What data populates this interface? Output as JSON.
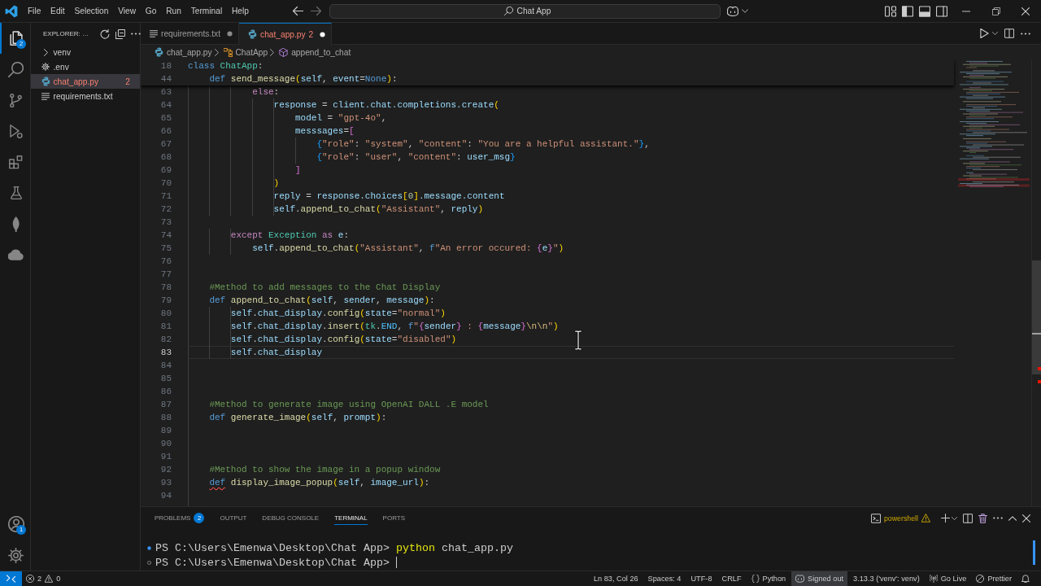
{
  "title_bar": {
    "menu": [
      "File",
      "Edit",
      "Selection",
      "View",
      "Go",
      "Run",
      "Terminal",
      "Help"
    ],
    "search_text": "Chat App"
  },
  "activity_bar": {
    "items": [
      {
        "kind": "files",
        "selected": true,
        "badge": "2"
      },
      {
        "kind": "search",
        "selected": false
      },
      {
        "kind": "source-control",
        "selected": false
      },
      {
        "kind": "run",
        "selected": false
      },
      {
        "kind": "extensions",
        "selected": false
      },
      {
        "kind": "testing",
        "selected": false
      },
      {
        "kind": "leaf",
        "selected": false
      },
      {
        "kind": "cloud",
        "selected": false
      }
    ],
    "bottom": [
      {
        "kind": "account",
        "badge": "1"
      },
      {
        "kind": "settings"
      }
    ]
  },
  "sidebar": {
    "title": "EXPLORER: …",
    "items": [
      {
        "kind": "folder",
        "name": "venv",
        "expanded": false,
        "selected": false,
        "has_errors": false
      },
      {
        "kind": "env",
        "name": ".env",
        "selected": false,
        "has_errors": false
      },
      {
        "kind": "python",
        "name": "chat_app.py",
        "problems": "2",
        "selected": true,
        "has_errors": true
      },
      {
        "kind": "text",
        "name": "requirements.txt",
        "selected": false,
        "has_errors": false
      }
    ]
  },
  "editor": {
    "tabs": [
      {
        "kind": "text",
        "label": "requirements.txt",
        "selected": false,
        "modified": true,
        "has_errors": false
      },
      {
        "kind": "python",
        "label": "chat_app.py",
        "problems": "2",
        "selected": true,
        "modified": true,
        "has_errors": true
      }
    ],
    "breadcrumbs": [
      {
        "kind": "python",
        "text": "chat_app.py"
      },
      {
        "kind": "class",
        "text": "ChatApp"
      },
      {
        "kind": "method",
        "text": "append_to_chat"
      }
    ],
    "sticky_lines": [
      {
        "number": "18",
        "tokens": [
          {
            "kind": "kw",
            "text": "class "
          },
          {
            "kind": "cls",
            "text": "ChatApp"
          },
          {
            "kind": "plain",
            "text": ":"
          }
        ]
      },
      {
        "number": "44",
        "tokens": [
          {
            "kind": "kw",
            "text": "    def "
          },
          {
            "kind": "fn",
            "text": "send_message"
          },
          {
            "kind": "br1",
            "text": "("
          },
          {
            "kind": "var",
            "text": "self"
          },
          {
            "kind": "plain",
            "text": ", "
          },
          {
            "kind": "var",
            "text": "event"
          },
          {
            "kind": "plain",
            "text": "="
          },
          {
            "kind": "kw",
            "text": "None"
          },
          {
            "kind": "br1",
            "text": ")"
          },
          {
            "kind": "plain",
            "text": ":"
          }
        ]
      }
    ],
    "lines": [
      {
        "number": "63",
        "current": false,
        "tokens": [
          {
            "kind": "ctrl",
            "text": "            else"
          },
          {
            "kind": "plain",
            "text": ":"
          }
        ]
      },
      {
        "number": "64",
        "current": false,
        "tokens": [
          {
            "kind": "var",
            "text": "                response"
          },
          {
            "kind": "plain",
            "text": " = "
          },
          {
            "kind": "var",
            "text": "client.chat.completions.create"
          },
          {
            "kind": "br1",
            "text": "("
          }
        ]
      },
      {
        "number": "65",
        "current": false,
        "tokens": [
          {
            "kind": "var",
            "text": "                    model"
          },
          {
            "kind": "plain",
            "text": " = "
          },
          {
            "kind": "str",
            "text": "\"gpt-4o\""
          },
          {
            "kind": "plain",
            "text": ","
          }
        ]
      },
      {
        "number": "66",
        "current": false,
        "tokens": [
          {
            "kind": "var",
            "text": "                    messsages"
          },
          {
            "kind": "plain",
            "text": "="
          },
          {
            "kind": "br2",
            "text": "["
          }
        ]
      },
      {
        "number": "67",
        "current": false,
        "tokens": [
          {
            "kind": "br3",
            "text": "                        {"
          },
          {
            "kind": "str",
            "text": "\"role\""
          },
          {
            "kind": "plain",
            "text": ": "
          },
          {
            "kind": "str",
            "text": "\"system\""
          },
          {
            "kind": "plain",
            "text": ", "
          },
          {
            "kind": "str",
            "text": "\"content\""
          },
          {
            "kind": "plain",
            "text": ": "
          },
          {
            "kind": "str",
            "text": "\"You are a helpful assistant.\""
          },
          {
            "kind": "br3",
            "text": "}"
          },
          {
            "kind": "plain",
            "text": ","
          }
        ]
      },
      {
        "number": "68",
        "current": false,
        "tokens": [
          {
            "kind": "br3",
            "text": "                        {"
          },
          {
            "kind": "str",
            "text": "\"role\""
          },
          {
            "kind": "plain",
            "text": ": "
          },
          {
            "kind": "str",
            "text": "\"user\""
          },
          {
            "kind": "plain",
            "text": ", "
          },
          {
            "kind": "str",
            "text": "\"content\""
          },
          {
            "kind": "plain",
            "text": ": "
          },
          {
            "kind": "var",
            "text": "user_msg"
          },
          {
            "kind": "br3",
            "text": "}"
          }
        ]
      },
      {
        "number": "69",
        "current": false,
        "tokens": [
          {
            "kind": "br2",
            "text": "                    ]"
          }
        ]
      },
      {
        "number": "70",
        "current": false,
        "tokens": [
          {
            "kind": "br1",
            "text": "                )"
          }
        ]
      },
      {
        "number": "71",
        "current": false,
        "tokens": [
          {
            "kind": "var",
            "text": "                reply"
          },
          {
            "kind": "plain",
            "text": " = "
          },
          {
            "kind": "var",
            "text": "response.choices"
          },
          {
            "kind": "br1",
            "text": "["
          },
          {
            "kind": "num",
            "text": "0"
          },
          {
            "kind": "br1",
            "text": "]"
          },
          {
            "kind": "var",
            "text": ".message.content"
          }
        ]
      },
      {
        "number": "72",
        "current": false,
        "tokens": [
          {
            "kind": "var",
            "text": "                self"
          },
          {
            "kind": "plain",
            "text": "."
          },
          {
            "kind": "fn",
            "text": "append_to_chat"
          },
          {
            "kind": "br1",
            "text": "("
          },
          {
            "kind": "str",
            "text": "\"Assistant\""
          },
          {
            "kind": "plain",
            "text": ", "
          },
          {
            "kind": "var",
            "text": "reply"
          },
          {
            "kind": "br1",
            "text": ")"
          }
        ]
      },
      {
        "number": "73",
        "current": false
      },
      {
        "number": "74",
        "current": false,
        "tokens": [
          {
            "kind": "ctrl",
            "text": "        except "
          },
          {
            "kind": "cls",
            "text": "Exception "
          },
          {
            "kind": "ctrl",
            "text": "as "
          },
          {
            "kind": "var",
            "text": "e"
          },
          {
            "kind": "plain",
            "text": ":"
          }
        ]
      },
      {
        "number": "75",
        "current": false,
        "tokens": [
          {
            "kind": "var",
            "text": "            self"
          },
          {
            "kind": "plain",
            "text": "."
          },
          {
            "kind": "fn",
            "text": "append_to_chat"
          },
          {
            "kind": "br1",
            "text": "("
          },
          {
            "kind": "str",
            "text": "\"Assistant\""
          },
          {
            "kind": "plain",
            "text": ", "
          },
          {
            "kind": "kw",
            "text": "f"
          },
          {
            "kind": "str",
            "text": "\"An error occured: "
          },
          {
            "kind": "br2",
            "text": "{"
          },
          {
            "kind": "var",
            "text": "e"
          },
          {
            "kind": "br2",
            "text": "}"
          },
          {
            "kind": "str",
            "text": "\""
          },
          {
            "kind": "br1",
            "text": ")"
          }
        ]
      },
      {
        "number": "76",
        "current": false
      },
      {
        "number": "77",
        "current": false
      },
      {
        "number": "78",
        "current": false,
        "tokens": [
          {
            "kind": "com",
            "text": "    #Method to add messages to the Chat Display"
          }
        ]
      },
      {
        "number": "79",
        "current": false,
        "tokens": [
          {
            "kind": "kw",
            "text": "    def "
          },
          {
            "kind": "fn",
            "text": "append_to_chat"
          },
          {
            "kind": "br1",
            "text": "("
          },
          {
            "kind": "var",
            "text": "self"
          },
          {
            "kind": "plain",
            "text": ", "
          },
          {
            "kind": "var",
            "text": "sender"
          },
          {
            "kind": "plain",
            "text": ", "
          },
          {
            "kind": "var",
            "text": "message"
          },
          {
            "kind": "br1",
            "text": ")"
          },
          {
            "kind": "plain",
            "text": ":"
          }
        ]
      },
      {
        "number": "80",
        "current": false,
        "tokens": [
          {
            "kind": "var",
            "text": "        self"
          },
          {
            "kind": "plain",
            "text": "."
          },
          {
            "kind": "var",
            "text": "chat_display"
          },
          {
            "kind": "plain",
            "text": "."
          },
          {
            "kind": "fn",
            "text": "config"
          },
          {
            "kind": "br1",
            "text": "("
          },
          {
            "kind": "var",
            "text": "state"
          },
          {
            "kind": "plain",
            "text": "="
          },
          {
            "kind": "str",
            "text": "\"normal\""
          },
          {
            "kind": "br1",
            "text": ")"
          }
        ]
      },
      {
        "number": "81",
        "current": false,
        "tokens": [
          {
            "kind": "var",
            "text": "        self"
          },
          {
            "kind": "plain",
            "text": "."
          },
          {
            "kind": "var",
            "text": "chat_display"
          },
          {
            "kind": "plain",
            "text": "."
          },
          {
            "kind": "fn",
            "text": "insert"
          },
          {
            "kind": "br1",
            "text": "("
          },
          {
            "kind": "mod",
            "text": "tk"
          },
          {
            "kind": "plain",
            "text": "."
          },
          {
            "kind": "const",
            "text": "END"
          },
          {
            "kind": "plain",
            "text": ", "
          },
          {
            "kind": "kw",
            "text": "f"
          },
          {
            "kind": "str",
            "text": "\""
          },
          {
            "kind": "br2",
            "text": "{"
          },
          {
            "kind": "var",
            "text": "sender"
          },
          {
            "kind": "br2",
            "text": "}"
          },
          {
            "kind": "str",
            "text": " : "
          },
          {
            "kind": "br2",
            "text": "{"
          },
          {
            "kind": "var",
            "text": "message"
          },
          {
            "kind": "br2",
            "text": "}"
          },
          {
            "kind": "esc",
            "text": "\\n\\n"
          },
          {
            "kind": "str",
            "text": "\""
          },
          {
            "kind": "br1",
            "text": ")"
          }
        ]
      },
      {
        "number": "82",
        "current": false,
        "tokens": [
          {
            "kind": "var",
            "text": "        self"
          },
          {
            "kind": "plain",
            "text": "."
          },
          {
            "kind": "var",
            "text": "chat_display"
          },
          {
            "kind": "plain",
            "text": "."
          },
          {
            "kind": "fn",
            "text": "config"
          },
          {
            "kind": "br1",
            "text": "("
          },
          {
            "kind": "var",
            "text": "state"
          },
          {
            "kind": "plain",
            "text": "="
          },
          {
            "kind": "str",
            "text": "\"disabled\""
          },
          {
            "kind": "br1",
            "text": ")"
          }
        ]
      },
      {
        "number": "83",
        "current": true,
        "tokens": [
          {
            "kind": "var",
            "text": "        self"
          },
          {
            "kind": "plain",
            "text": "."
          },
          {
            "kind": "var",
            "text": "chat_display"
          }
        ]
      },
      {
        "number": "84",
        "current": false
      },
      {
        "number": "85",
        "current": false
      },
      {
        "number": "86",
        "current": false
      },
      {
        "number": "87",
        "current": false,
        "tokens": [
          {
            "kind": "com",
            "text": "    #Method to generate image using OpenAI DALL .E model"
          }
        ]
      },
      {
        "number": "88",
        "current": false,
        "tokens": [
          {
            "kind": "kw",
            "text": "    def "
          },
          {
            "kind": "fn",
            "text": "generate_image"
          },
          {
            "kind": "br1",
            "text": "("
          },
          {
            "kind": "var",
            "text": "self"
          },
          {
            "kind": "plain",
            "text": ", "
          },
          {
            "kind": "var",
            "text": "prompt"
          },
          {
            "kind": "br1",
            "text": ")"
          },
          {
            "kind": "plain",
            "text": ":"
          }
        ]
      },
      {
        "number": "89",
        "current": false
      },
      {
        "number": "90",
        "current": false
      },
      {
        "number": "91",
        "current": false
      },
      {
        "number": "92",
        "current": false,
        "tokens": [
          {
            "kind": "com",
            "text": "    #Method to show the image in a popup window"
          }
        ]
      },
      {
        "number": "93",
        "current": false,
        "tokens": [
          {
            "kind": "kw",
            "text": "    def",
            "error": true
          },
          {
            "kind": "fn",
            "text": " display_image_popup"
          },
          {
            "kind": "br1",
            "text": "("
          },
          {
            "kind": "var",
            "text": "self"
          },
          {
            "kind": "plain",
            "text": ", "
          },
          {
            "kind": "var",
            "text": "image_url"
          },
          {
            "kind": "br1",
            "text": ")"
          },
          {
            "kind": "plain",
            "text": ":"
          }
        ]
      },
      {
        "number": "94",
        "current": false
      }
    ]
  },
  "panel": {
    "tabs": [
      {
        "label": "PROBLEMS",
        "badge": "2",
        "selected": false
      },
      {
        "label": "OUTPUT",
        "selected": false
      },
      {
        "label": "DEBUG CONSOLE",
        "selected": false
      },
      {
        "label": "TERMINAL",
        "selected": true
      },
      {
        "label": "PORTS",
        "selected": false
      }
    ],
    "shell": "powershell",
    "terminal": [
      {
        "completed": true,
        "prompt": "PS C:\\Users\\Emenwa\\Desktop\\Chat App>",
        "command": "python",
        "argument": "chat_app.py",
        "cursor": false
      },
      {
        "completed": false,
        "prompt": "PS C:\\Users\\Emenwa\\Desktop\\Chat App>",
        "cursor": true
      }
    ]
  },
  "status_bar": {
    "left": [
      {
        "kind": "remote"
      },
      {
        "kind": "problems",
        "errors": "2",
        "warnings": "0"
      }
    ],
    "right": [
      {
        "kind": "text",
        "text": "Ln 83, Col 26",
        "highlighted": false
      },
      {
        "kind": "text",
        "text": "Spaces: 4",
        "highlighted": false
      },
      {
        "kind": "text",
        "text": "UTF-8",
        "highlighted": false
      },
      {
        "kind": "text",
        "text": "CRLF",
        "highlighted": false
      },
      {
        "kind": "language",
        "text": "Python",
        "highlighted": false
      },
      {
        "kind": "copilot",
        "text": "Signed out",
        "highlighted": true
      },
      {
        "kind": "text",
        "text": "3.13.3 ('venv': venv)",
        "highlighted": false
      },
      {
        "kind": "live",
        "text": "Go Live",
        "highlighted": false
      },
      {
        "kind": "prettier",
        "text": "Prettier",
        "highlighted": false
      },
      {
        "kind": "bell"
      }
    ]
  }
}
